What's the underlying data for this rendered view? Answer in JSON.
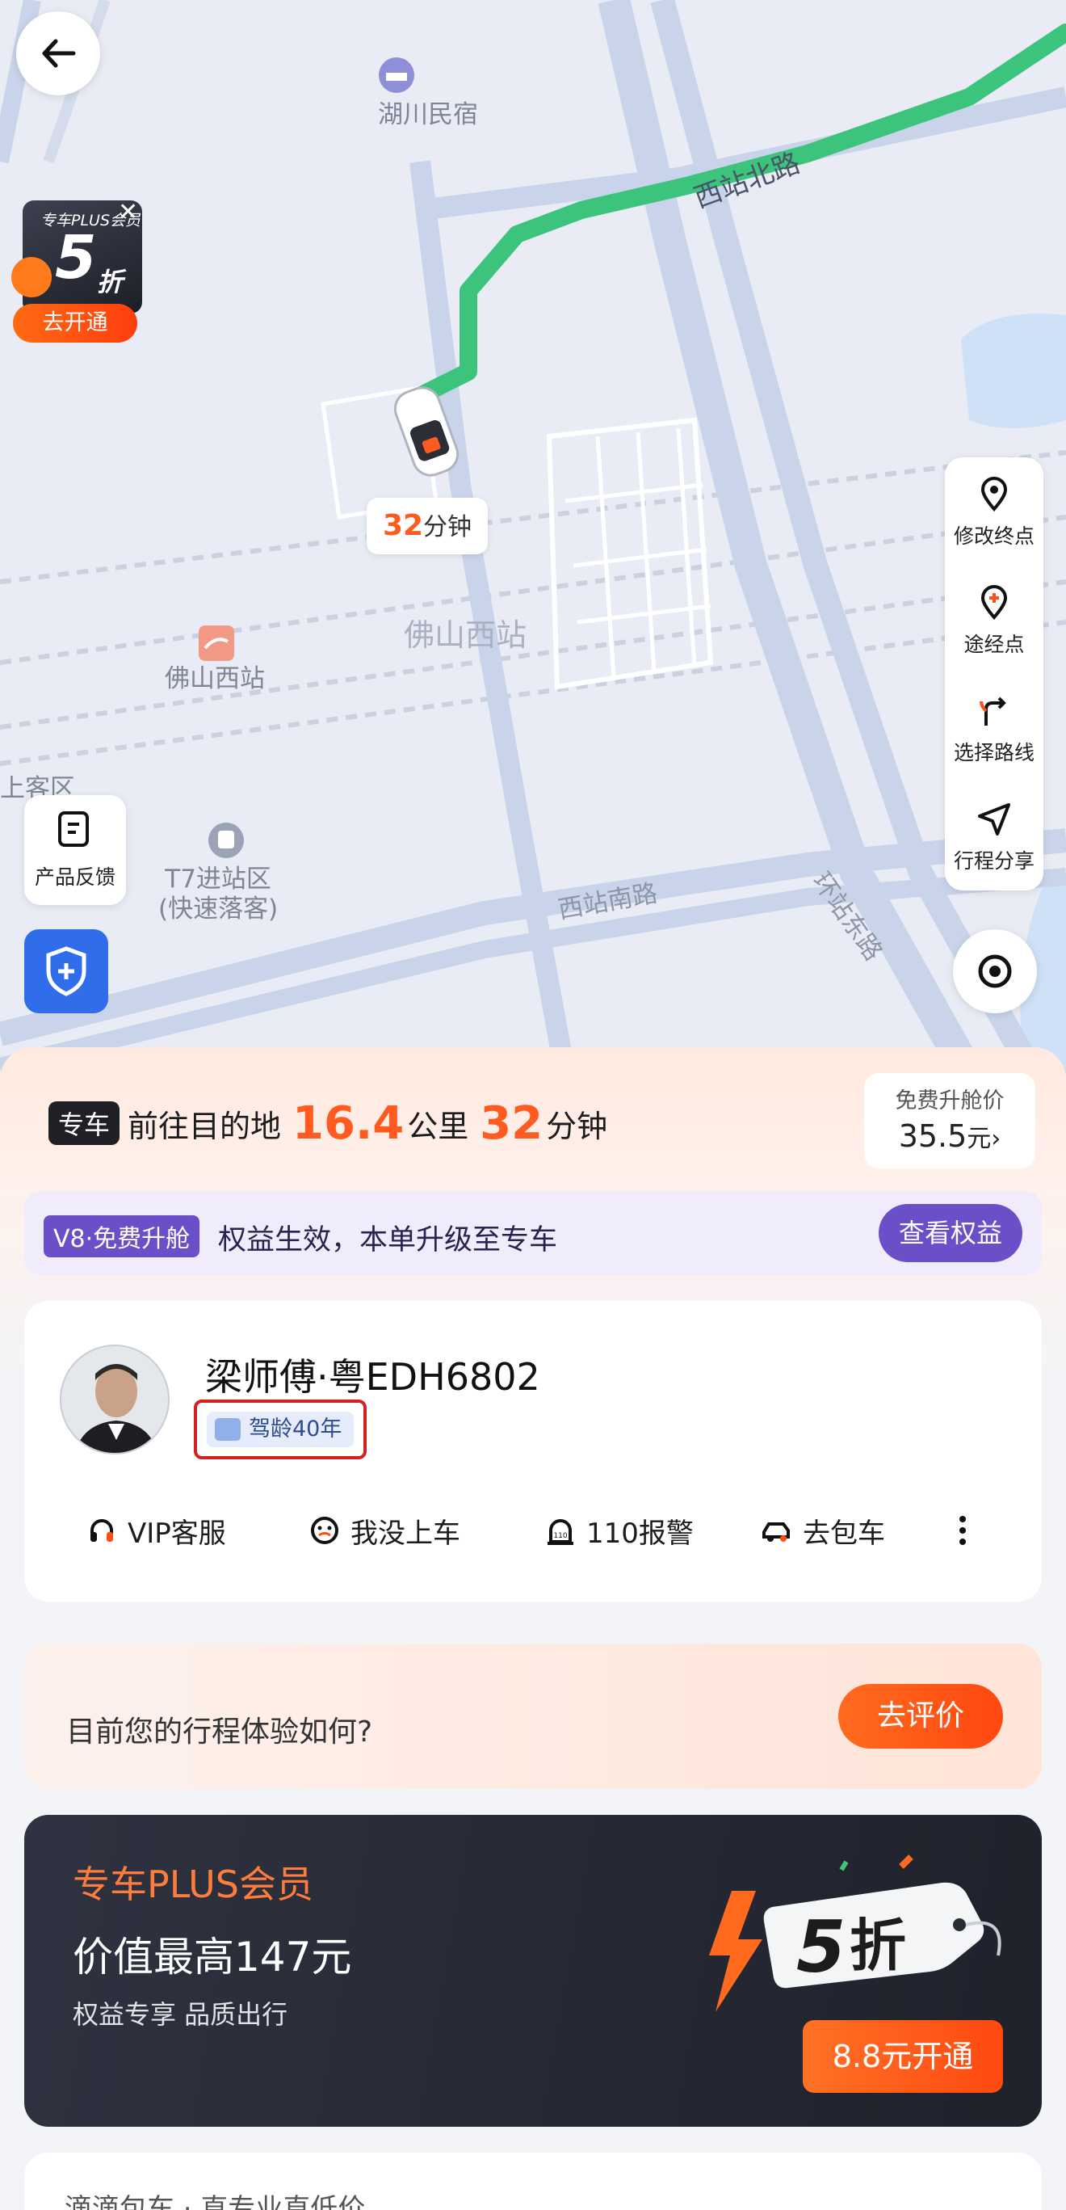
{
  "map": {
    "poi_hotel": "湖川民宿",
    "poi_station_icon_label": "佛山西站",
    "poi_station_big": "佛山西站",
    "poi_t7": "T7进站区\n(快速落客)",
    "road_north": "西站北路",
    "road_south": "西站南路",
    "road_east": "环站东路",
    "area_left": "上客区",
    "eta_number": "32",
    "eta_unit": "分钟"
  },
  "promo_badge": {
    "top": "专车PLUS会员",
    "discount_number": "5",
    "discount_unit": "折",
    "cta": "去开通"
  },
  "side_tools": [
    {
      "label": "修改终点",
      "icon": "location-pin-icon"
    },
    {
      "label": "途经点",
      "icon": "add-waypoint-icon"
    },
    {
      "label": "选择路线",
      "icon": "route-icon"
    },
    {
      "label": "行程分享",
      "icon": "share-send-icon"
    }
  ],
  "feedback": {
    "label": "产品反馈"
  },
  "trip_status": {
    "tag": "专车",
    "prefix": "前往目的地",
    "distance": "16.4",
    "distance_unit": "公里",
    "time": "32",
    "time_unit": "分钟"
  },
  "upgrade_price": {
    "title": "免费升舱价",
    "amount": "35.5",
    "unit": "元",
    "arrow": "›"
  },
  "vip_strip": {
    "tag": "V8·免费升舱",
    "text": "权益生效，本单升级至专车",
    "button": "查看权益"
  },
  "driver": {
    "name": "梁师傅·粤EDH6802",
    "drive_age": "驾龄40年",
    "actions": [
      {
        "label": "VIP客服",
        "icon": "headset-icon"
      },
      {
        "label": "我没上车",
        "icon": "face-icon"
      },
      {
        "label": "110报警",
        "icon": "alarm-icon"
      },
      {
        "label": "去包车",
        "icon": "car-icon"
      }
    ]
  },
  "rating": {
    "question": "目前您的行程体验如何?",
    "button": "去评价"
  },
  "plus_card": {
    "title": "专车PLUS会员",
    "value": "价值最高147元",
    "subtitle": "权益专享 品质出行",
    "discount_number": "5",
    "discount_unit": "折",
    "button": "8.8元开通"
  },
  "bottom_card": {
    "text": "滴滴包车 · 直专业直低价"
  },
  "colors": {
    "accent": "#ff5a1f",
    "route": "#3cc47c",
    "vip_purple": "#6a4fc8",
    "dark_card": "#25272f"
  }
}
